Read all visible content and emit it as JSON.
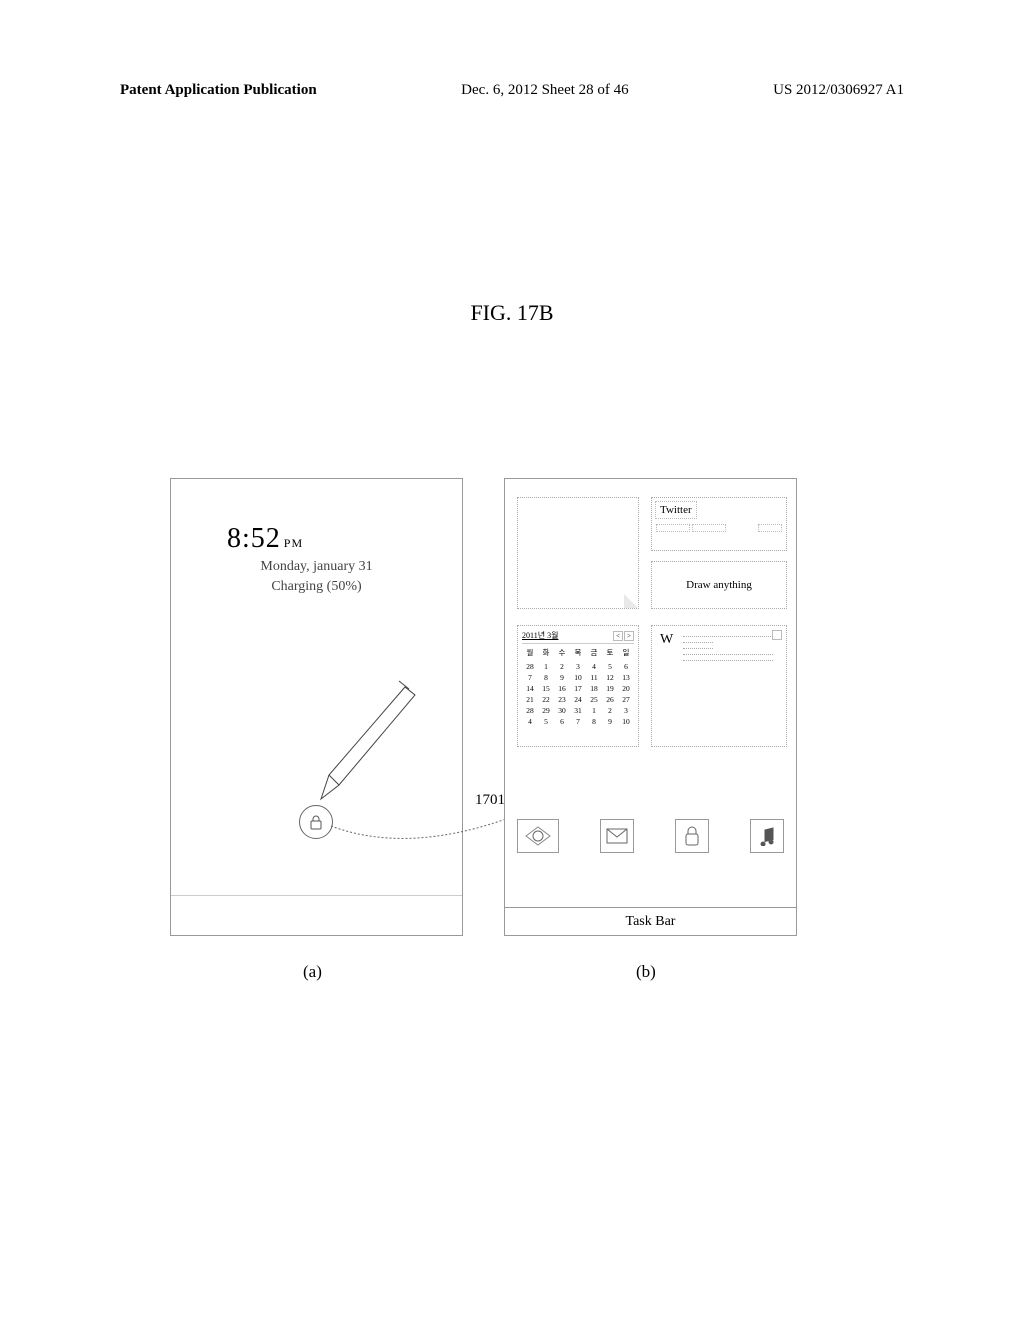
{
  "header": {
    "left": "Patent Application Publication",
    "center": "Dec. 6, 2012  Sheet 28 of 46",
    "right": "US 2012/0306927 A1"
  },
  "figure_title": "FIG. 17B",
  "panel_a": {
    "time": "8:52",
    "ampm": "PM",
    "date": "Monday, january 31",
    "charging": "Charging (50%)",
    "label": "(a)"
  },
  "panel_b": {
    "twitter": "Twitter",
    "draw": "Draw anything",
    "cal_title": "2011년 3월",
    "cal_days": [
      "월",
      "화",
      "수",
      "목",
      "금",
      "토",
      "일"
    ],
    "cal_nums": [
      28,
      1,
      2,
      3,
      4,
      5,
      6,
      7,
      8,
      9,
      10,
      11,
      12,
      13,
      14,
      15,
      16,
      17,
      18,
      19,
      20,
      21,
      22,
      23,
      24,
      25,
      26,
      27,
      28,
      29,
      30,
      31,
      1,
      2,
      3,
      4,
      5,
      6,
      7,
      8,
      9,
      10
    ],
    "weather_letter": "W",
    "taskbar": "Task Bar",
    "label": "(b)"
  },
  "annotation": "1701"
}
